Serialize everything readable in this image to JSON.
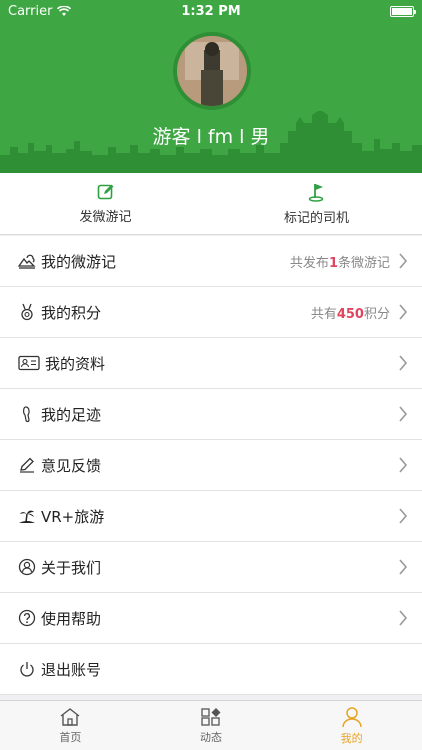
{
  "status_bar": {
    "carrier": "Carrier",
    "time": "1:32 PM"
  },
  "profile": {
    "name_line": "游客 l fm l 男"
  },
  "quick_actions": [
    {
      "label": "发微游记",
      "icon": "edit-icon"
    },
    {
      "label": "标记的司机",
      "icon": "flag-icon"
    }
  ],
  "menu": {
    "travelogue": {
      "label": "我的微游记",
      "info_prefix": "共发布",
      "info_num": "1",
      "info_suffix": "条微游记"
    },
    "points": {
      "label": "我的积分",
      "info_prefix": "共有",
      "info_num": "450",
      "info_suffix": "积分"
    },
    "profile_info": {
      "label": "我的资料"
    },
    "footprints": {
      "label": "我的足迹"
    },
    "feedback": {
      "label": "意见反馈"
    },
    "vr_travel": {
      "label": "VR+旅游"
    },
    "about": {
      "label": "关于我们"
    },
    "help": {
      "label": "使用帮助"
    },
    "logout": {
      "label": "退出账号"
    }
  },
  "tabs": [
    {
      "label": "首页",
      "icon": "home-icon",
      "active": false
    },
    {
      "label": "动态",
      "icon": "grid-icon",
      "active": false
    },
    {
      "label": "我的",
      "icon": "user-icon",
      "active": true
    }
  ],
  "colors": {
    "header_green": "#3ea744",
    "accent_orange": "#e9a322",
    "highlight_pink": "#e0455f"
  }
}
